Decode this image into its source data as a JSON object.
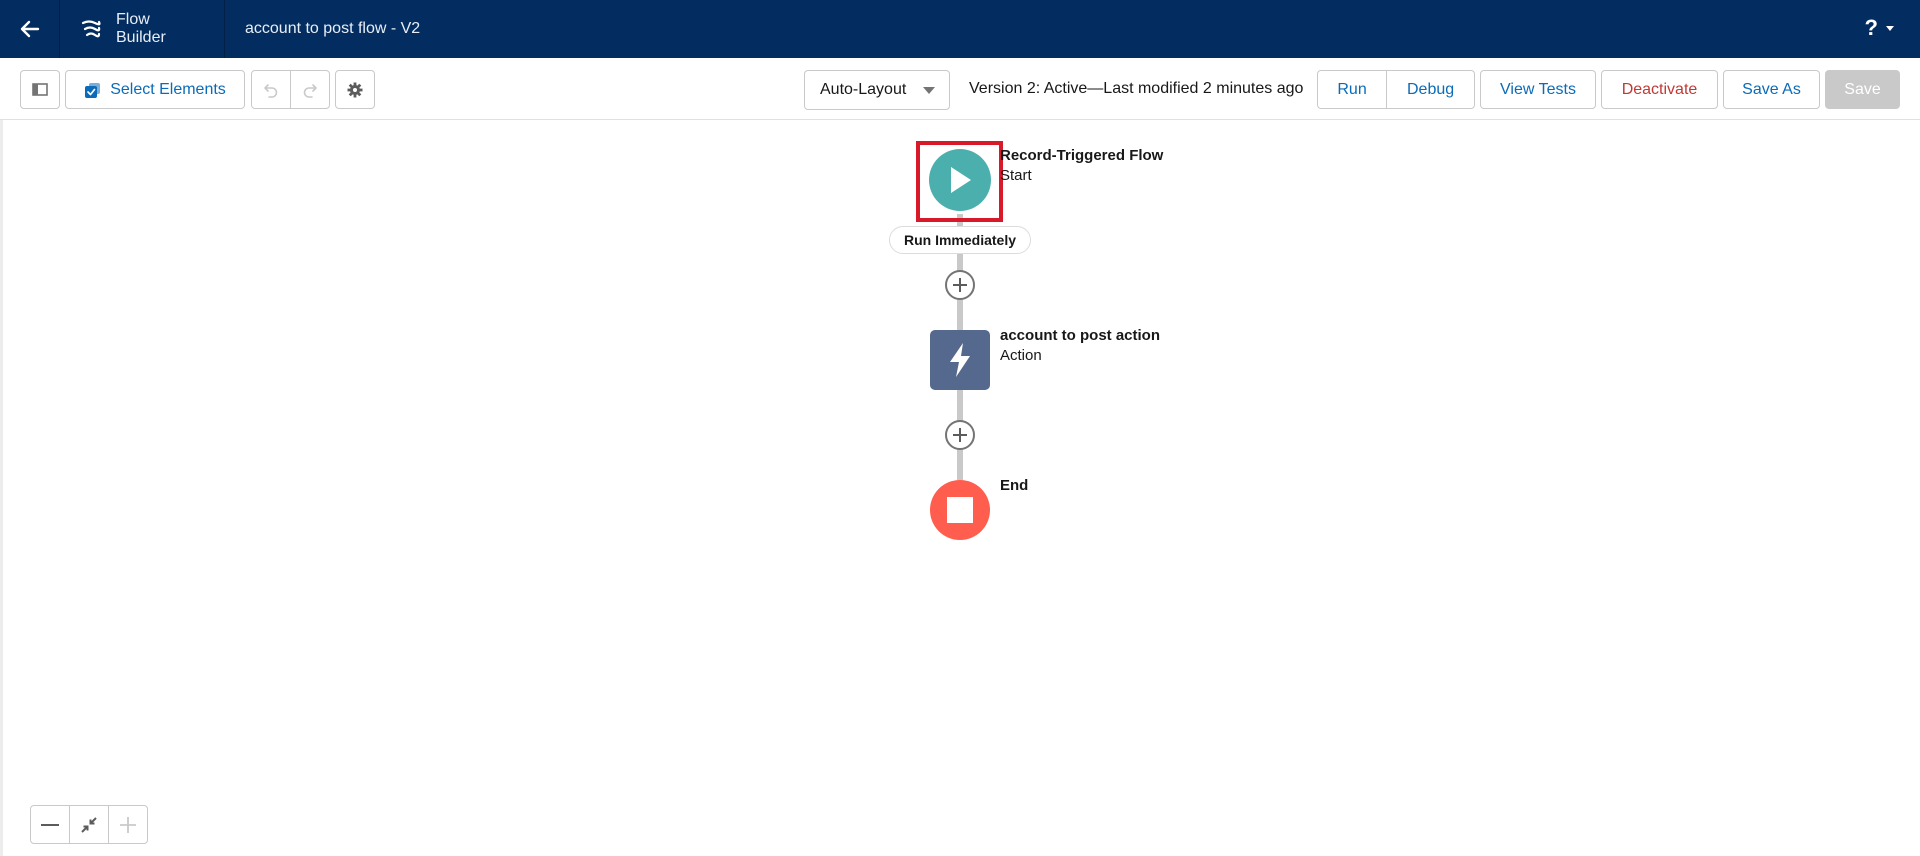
{
  "header": {
    "back_icon": "arrow-left-icon",
    "app_name": "Flow Builder",
    "app_icon": "flow-builder-icon",
    "flow_title": "account to post flow - V2",
    "help_label": "?",
    "help_icon": "help-icon"
  },
  "toolbar": {
    "toggle_panel_icon": "panel-toggle-icon",
    "select_elements_label": "Select Elements",
    "undo_icon": "undo-icon",
    "redo_icon": "redo-icon",
    "settings_icon": "gear-icon",
    "layout_mode": "Auto-Layout",
    "version_status": "Version 2: Active—Last modified 2 minutes ago",
    "run_label": "Run",
    "debug_label": "Debug",
    "view_tests_label": "View Tests",
    "deactivate_label": "Deactivate",
    "save_as_label": "Save As",
    "save_label": "Save"
  },
  "canvas": {
    "start": {
      "title": "Record-Triggered Flow",
      "subtitle": "Start",
      "icon": "play-icon",
      "color": "#4bb0ad",
      "highlighted": true
    },
    "path_label": "Run Immediately",
    "action": {
      "title": "account to post action",
      "subtitle": "Action",
      "icon": "lightning-icon",
      "color": "#54698d"
    },
    "end": {
      "title": "End",
      "icon": "stop-icon",
      "color": "#ff5d4d"
    },
    "add_element_icon": "plus-circle-icon"
  },
  "zoom_controls": {
    "zoom_out_icon": "minus-icon",
    "fit_icon": "fit-to-screen-icon",
    "zoom_in_icon": "plus-icon"
  },
  "colors": {
    "header_bg": "#032d60",
    "link_blue": "#0b6bb8",
    "destructive_red": "#c23934",
    "highlight_red": "#d7192a"
  }
}
